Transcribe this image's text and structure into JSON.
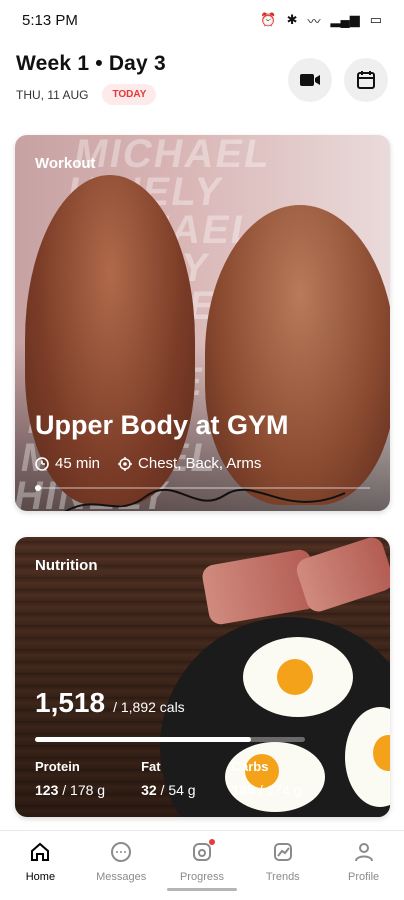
{
  "status_bar": {
    "time": "5:13 PM",
    "icons": [
      "alarm-icon",
      "bluetooth-icon",
      "wifi-icon",
      "signal-icon",
      "battery-icon"
    ]
  },
  "header": {
    "title": "Week 1 • Day 3",
    "date": "THU, 11 AUG",
    "today_badge": "TODAY",
    "buttons": [
      "video-button",
      "calendar-button"
    ]
  },
  "workout": {
    "label": "Workout",
    "title": "Upper Body at GYM",
    "duration": "45 min",
    "target": "Chest, Back, Arms",
    "pager_dots": 1
  },
  "nutrition": {
    "label": "Nutrition",
    "calories": "1,518",
    "calories_goal": "/ 1,892 cals",
    "progress": 0.8,
    "macros": [
      {
        "label": "Protein",
        "value": "123",
        "goal": "/ 178 g"
      },
      {
        "label": "Fat",
        "value": "32",
        "goal": "/ 54 g"
      },
      {
        "label": "Carbs",
        "value": "185",
        "goal": "/ 174 g"
      }
    ]
  },
  "nav": {
    "items": [
      {
        "label": "Home",
        "icon": "home-icon",
        "active": true
      },
      {
        "label": "Messages",
        "icon": "messages-icon",
        "active": false
      },
      {
        "label": "Progress",
        "icon": "progress-icon",
        "active": false
      },
      {
        "label": "Trends",
        "icon": "trends-icon",
        "active": false
      },
      {
        "label": "Profile",
        "icon": "profile-icon",
        "active": false
      }
    ]
  },
  "colors": {
    "accent": "#e23a3a",
    "today_bg": "#fdeaea"
  }
}
